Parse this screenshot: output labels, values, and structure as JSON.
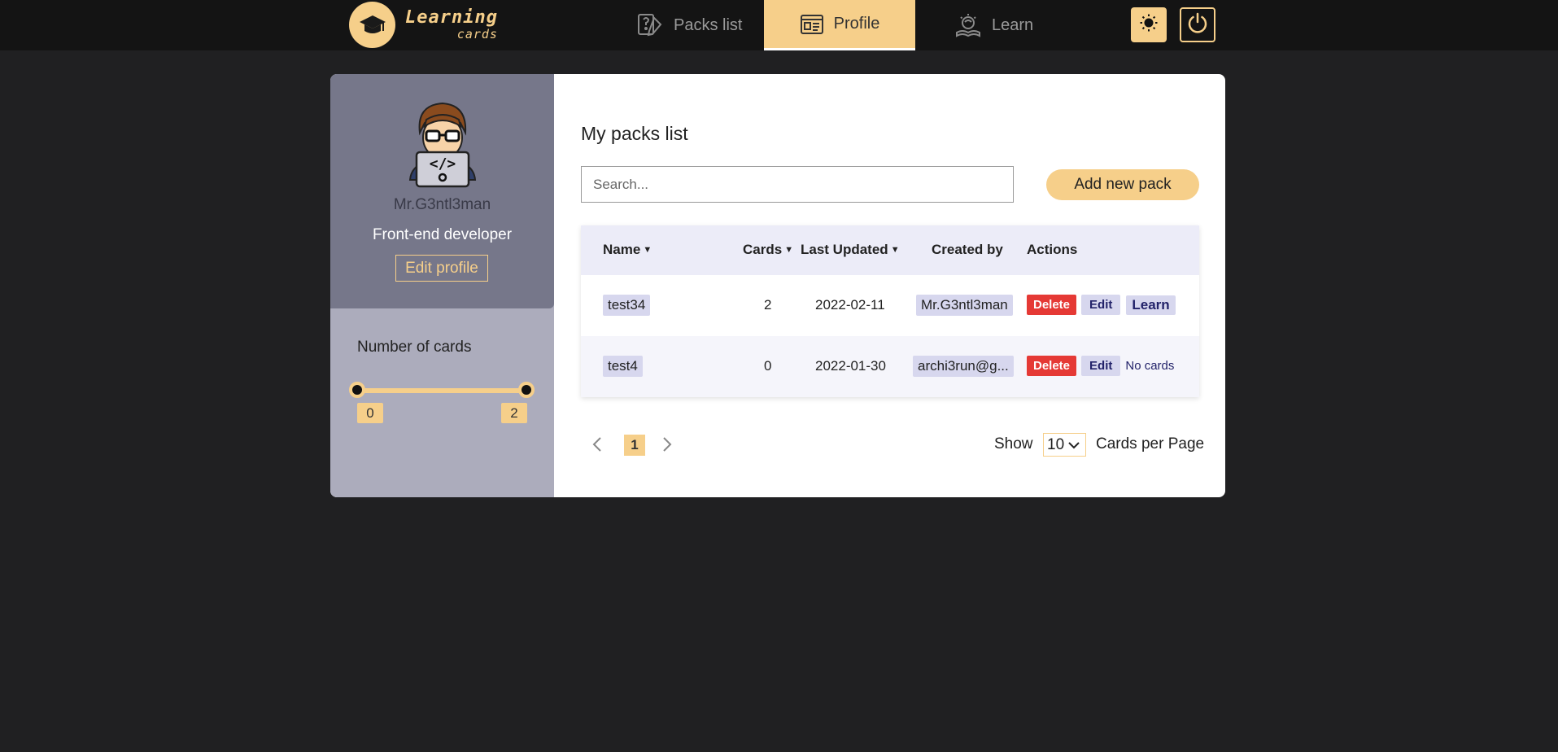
{
  "header": {
    "logo": {
      "line1": "Learning",
      "line2": "cards"
    },
    "nav": [
      {
        "label": "Packs list",
        "icon": "packs-icon",
        "active": false
      },
      {
        "label": "Profile",
        "icon": "profile-card-icon",
        "active": true
      },
      {
        "label": "Learn",
        "icon": "learn-icon",
        "active": false
      }
    ],
    "theme_icon": "sun-icon",
    "logout_icon": "power-icon"
  },
  "colors": {
    "accent": "#f6cf8a",
    "background": "#202022",
    "sidebar": "#acacbc",
    "profile_box": "#76778a",
    "delete": "#e53935"
  },
  "profile": {
    "username": "Mr.G3ntl3man",
    "job": "Front-end developer",
    "edit_label": "Edit profile"
  },
  "filter": {
    "label": "Number of cards",
    "min": "0",
    "max": "2"
  },
  "main": {
    "title": "My packs list",
    "search_placeholder": "Search...",
    "add_label": "Add new pack",
    "table": {
      "headers": {
        "name": "Name",
        "cards": "Cards",
        "updated": "Last Updated",
        "created": "Created by",
        "actions": "Actions"
      },
      "rows": [
        {
          "name": "test34",
          "cards": "2",
          "updated": "2022-02-11",
          "created": "Mr.G3ntl3man",
          "delete": "Delete",
          "edit": "Edit",
          "learn": "Learn"
        },
        {
          "name": "test4",
          "cards": "0",
          "updated": "2022-01-30",
          "created": "archi3run@g...",
          "delete": "Delete",
          "edit": "Edit",
          "learn": "No cards"
        }
      ]
    },
    "pagination": {
      "current_page": "1",
      "show_label": "Show",
      "per_page": "10",
      "per_page_label": "Cards per Page"
    }
  }
}
